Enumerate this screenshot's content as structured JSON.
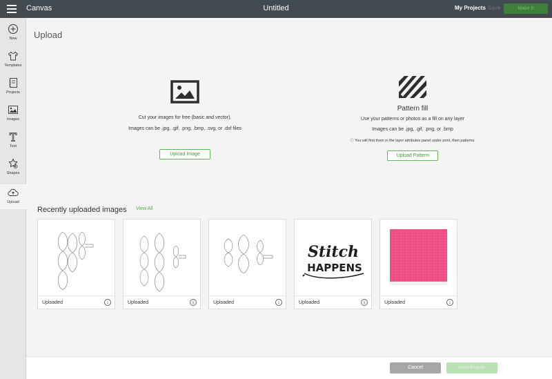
{
  "topbar": {
    "app_title": "Canvas",
    "document_title": "Untitled",
    "my_projects": "My Projects",
    "save": "Save",
    "make_it": "Make It"
  },
  "sidebar": {
    "items": [
      {
        "label": "New",
        "icon": "plus-circle-icon"
      },
      {
        "label": "Templates",
        "icon": "tshirt-icon"
      },
      {
        "label": "Projects",
        "icon": "notebook-icon"
      },
      {
        "label": "Images",
        "icon": "image-icon"
      },
      {
        "label": "Text",
        "icon": "text-icon"
      },
      {
        "label": "Shapes",
        "icon": "shapes-icon"
      },
      {
        "label": "Upload",
        "icon": "cloud-upload-icon",
        "active": true
      }
    ]
  },
  "main": {
    "title": "Upload",
    "upload_image": {
      "line1": "Cut your images for free (basic and vector).",
      "line2": "Images can be .jpg, .gif, .png, .bmp, .svg, or .dxf files",
      "button": "Upload Image"
    },
    "pattern_fill": {
      "heading": "Pattern fill",
      "line1": "Use your patterns or photos as a fill on any layer",
      "line2": "Images can be .jpg, .gif, .png, or .bmp",
      "note": "ⓘ You will find them in the layer attributes panel under print, then patterns.",
      "button": "Upload Pattern"
    },
    "recent": {
      "title": "Recently uploaded images",
      "view_all": "View All",
      "cards": [
        {
          "label": "Uploaded",
          "kind": "leaf-outline"
        },
        {
          "label": "Uploaded",
          "kind": "leaf-outline"
        },
        {
          "label": "Uploaded",
          "kind": "leaf-outline"
        },
        {
          "label": "Uploaded",
          "kind": "stitch-happens",
          "line1": "Stitch",
          "line2": "HAPPENS"
        },
        {
          "label": "Uploaded",
          "kind": "pink-pattern",
          "color": "#ef4f85"
        }
      ]
    }
  },
  "footer": {
    "cancel": "Cancel",
    "insert": "Insert Projects"
  },
  "colors": {
    "topbar": "#434a4f",
    "accent_green": "#66b25e",
    "make_it_bg": "#3f7f3c",
    "pattern_pink": "#ef4f85"
  }
}
